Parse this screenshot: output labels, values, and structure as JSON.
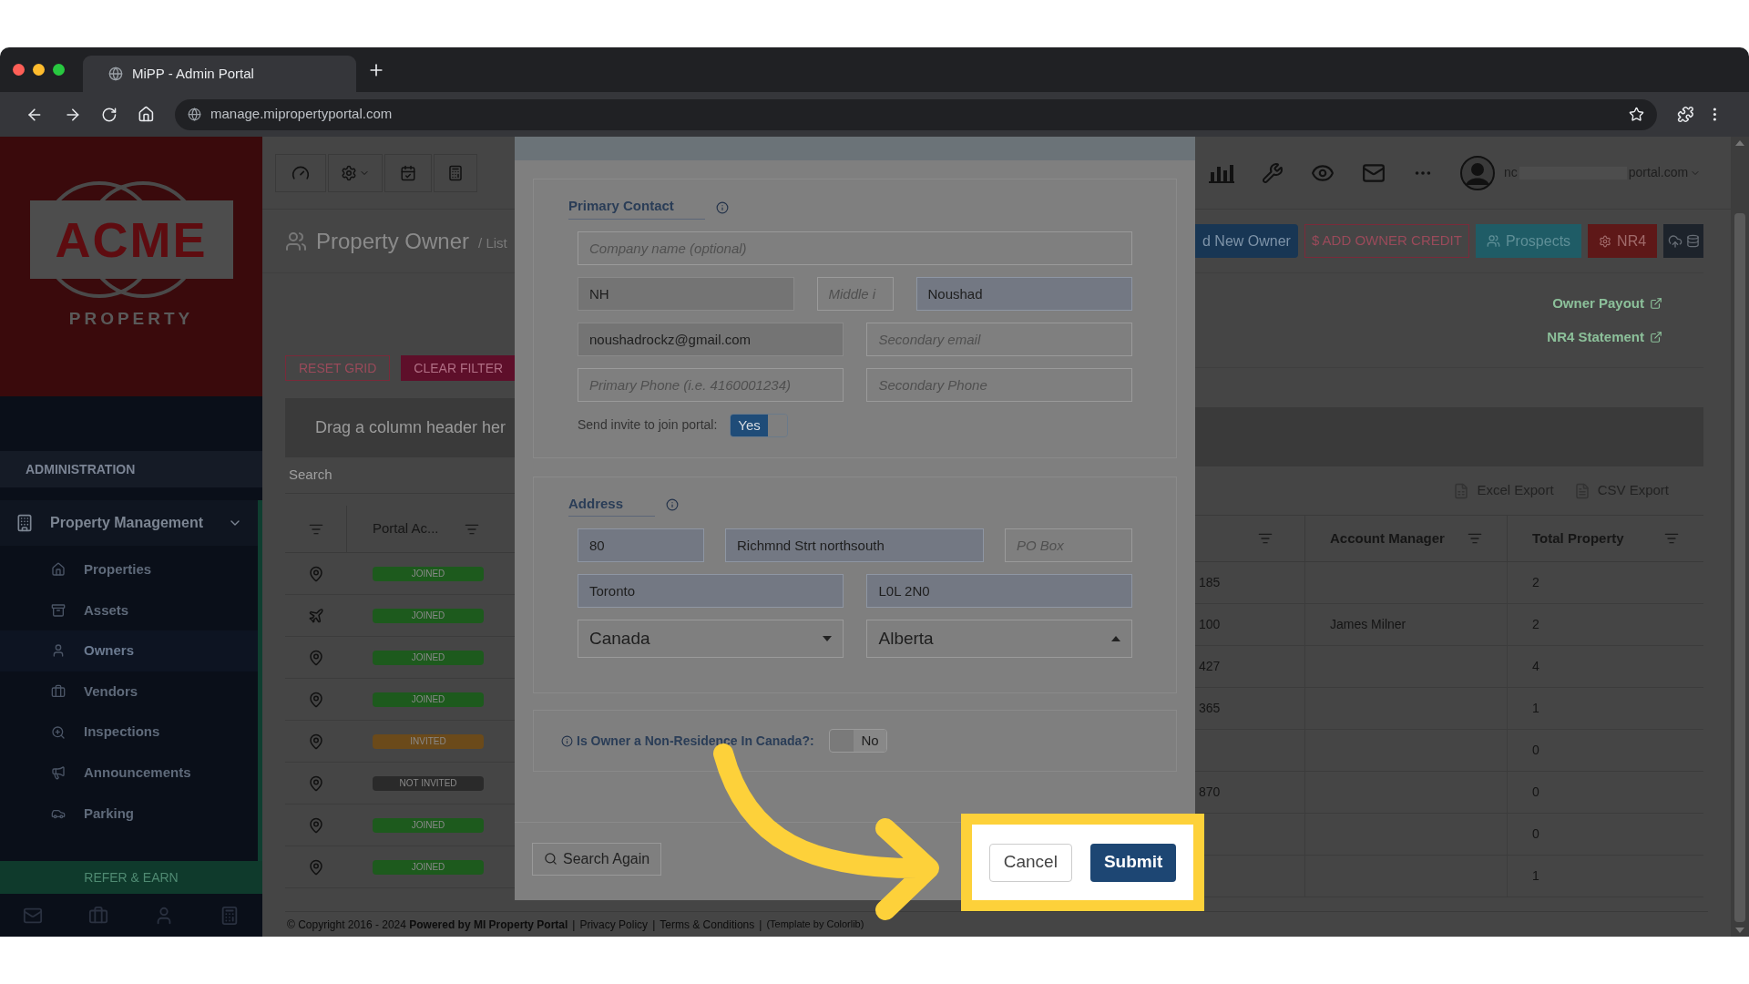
{
  "browser": {
    "tab_title": "MiPP - Admin Portal",
    "url": "manage.mipropertyportal.com"
  },
  "sidebar": {
    "logo": {
      "wordmark": "ACME",
      "tagline": "PROPERTY"
    },
    "section_label": "ADMINISTRATION",
    "group": {
      "label": "Property Management",
      "expanded": true
    },
    "items": [
      {
        "label": "Properties",
        "kind": "house",
        "selected": false
      },
      {
        "label": "Assets",
        "kind": "archive",
        "selected": false
      },
      {
        "label": "Owners",
        "kind": "user",
        "selected": true
      },
      {
        "label": "Vendors",
        "kind": "briefcase",
        "selected": false
      },
      {
        "label": "Inspections",
        "kind": "zoom",
        "selected": false
      },
      {
        "label": "Announcements",
        "kind": "megaphone",
        "selected": false
      },
      {
        "label": "Parking",
        "kind": "car",
        "selected": false
      }
    ],
    "refer_button": "REFER & EARN"
  },
  "user": {
    "email_start": "nc",
    "email_end": "portal.com"
  },
  "page": {
    "title": "Property Owner",
    "breadcrumb": "/ List"
  },
  "grid_buttons": [
    {
      "label": "RESET GRID",
      "kind": "outline"
    },
    {
      "label": "CLEAR FILTER",
      "kind": "solid"
    }
  ],
  "action_buttons": [
    {
      "label": "d New Owner",
      "kind": "primary"
    },
    {
      "label": "$ ADD OWNER CREDIT",
      "kind": "outline"
    },
    {
      "label": "Prospects",
      "kind": "teal"
    },
    {
      "label": "NR4",
      "kind": "danger"
    },
    {
      "kind": "upload"
    }
  ],
  "links": [
    "Owner Payout",
    "NR4 Statement"
  ],
  "group_hint": "Drag a column header her",
  "search": {
    "placeholder": "Search"
  },
  "exports": [
    {
      "label": "Excel Export",
      "kind": "excel"
    },
    {
      "label": "CSV Export",
      "kind": "csv"
    }
  ],
  "table": {
    "columns": [
      "Portal Ac...",
      "Account Manager",
      "Total Property"
    ],
    "rows": [
      {
        "kind": "pin",
        "status": {
          "label": "JOINED",
          "color": "#1d5a1d"
        },
        "column_3": "185",
        "manager": "",
        "total": "2"
      },
      {
        "kind": "plane",
        "status": {
          "label": "JOINED",
          "color": "#1d5a1d"
        },
        "column_3": "100",
        "manager": "James Milner",
        "total": "2"
      },
      {
        "kind": "pin",
        "status": {
          "label": "JOINED",
          "color": "#1d5a1d"
        },
        "column_3": "427",
        "manager": "",
        "total": "4"
      },
      {
        "kind": "pin",
        "status": {
          "label": "JOINED",
          "color": "#1d5a1d"
        },
        "column_3": "365",
        "manager": "",
        "total": "1"
      },
      {
        "kind": "pin",
        "status": {
          "label": "INVITED",
          "color": "#6b4a1a"
        },
        "column_3": "",
        "manager": "",
        "total": "0"
      },
      {
        "kind": "pin",
        "status": {
          "label": "NOT INVITED",
          "color": "#2a2a2a"
        },
        "column_3": "870",
        "manager": "",
        "total": "0"
      },
      {
        "kind": "pin",
        "status": {
          "label": "JOINED",
          "color": "#1d5a1d"
        },
        "column_3": "",
        "manager": "",
        "total": "0"
      },
      {
        "kind": "pin",
        "status": {
          "label": "JOINED",
          "color": "#1d5a1d"
        },
        "column_3": "",
        "manager": "",
        "total": "1"
      }
    ]
  },
  "modal": {
    "primary_contact": {
      "title": "Primary Contact",
      "company": {
        "placeholder": "Company name (optional)"
      },
      "first_name": {
        "value": "NH"
      },
      "middle": {
        "placeholder": "Middle i"
      },
      "last_name": {
        "value": "Noushad"
      },
      "email": {
        "value": "noushadrockz@gmail.com"
      },
      "secondary_email": {
        "placeholder": "Secondary email"
      },
      "primary_phone": {
        "placeholder": "Primary Phone (i.e. 4160001234)"
      },
      "secondary_phone": {
        "placeholder": "Secondary Phone"
      },
      "invite": {
        "label": "Send invite to join portal:",
        "value": "Yes",
        "on": true
      }
    },
    "address": {
      "title": "Address",
      "number": {
        "value": "80"
      },
      "street": {
        "value": "Richmnd Strt northsouth"
      },
      "po_box": {
        "placeholder": "PO Box"
      },
      "city": {
        "value": "Toronto"
      },
      "postal": {
        "value": "L0L 2N0"
      },
      "country": {
        "value": "Canada",
        "expanded": false
      },
      "province": {
        "value": "Alberta",
        "expanded": true
      }
    },
    "non_resident": {
      "label": "Is Owner a Non-Residence In Canada?:",
      "value": "No",
      "on": false
    },
    "search_again": "Search Again",
    "cancel": "Cancel",
    "submit": "Submit"
  },
  "footer": {
    "copyright": "© Copyright 2016 - 2024 **Powered by MI Property Portal**",
    "links": [
      "Privacy Policy",
      "Terms & Conditions"
    ],
    "note": "(Template by Colorlib)",
    "separator": "|"
  }
}
